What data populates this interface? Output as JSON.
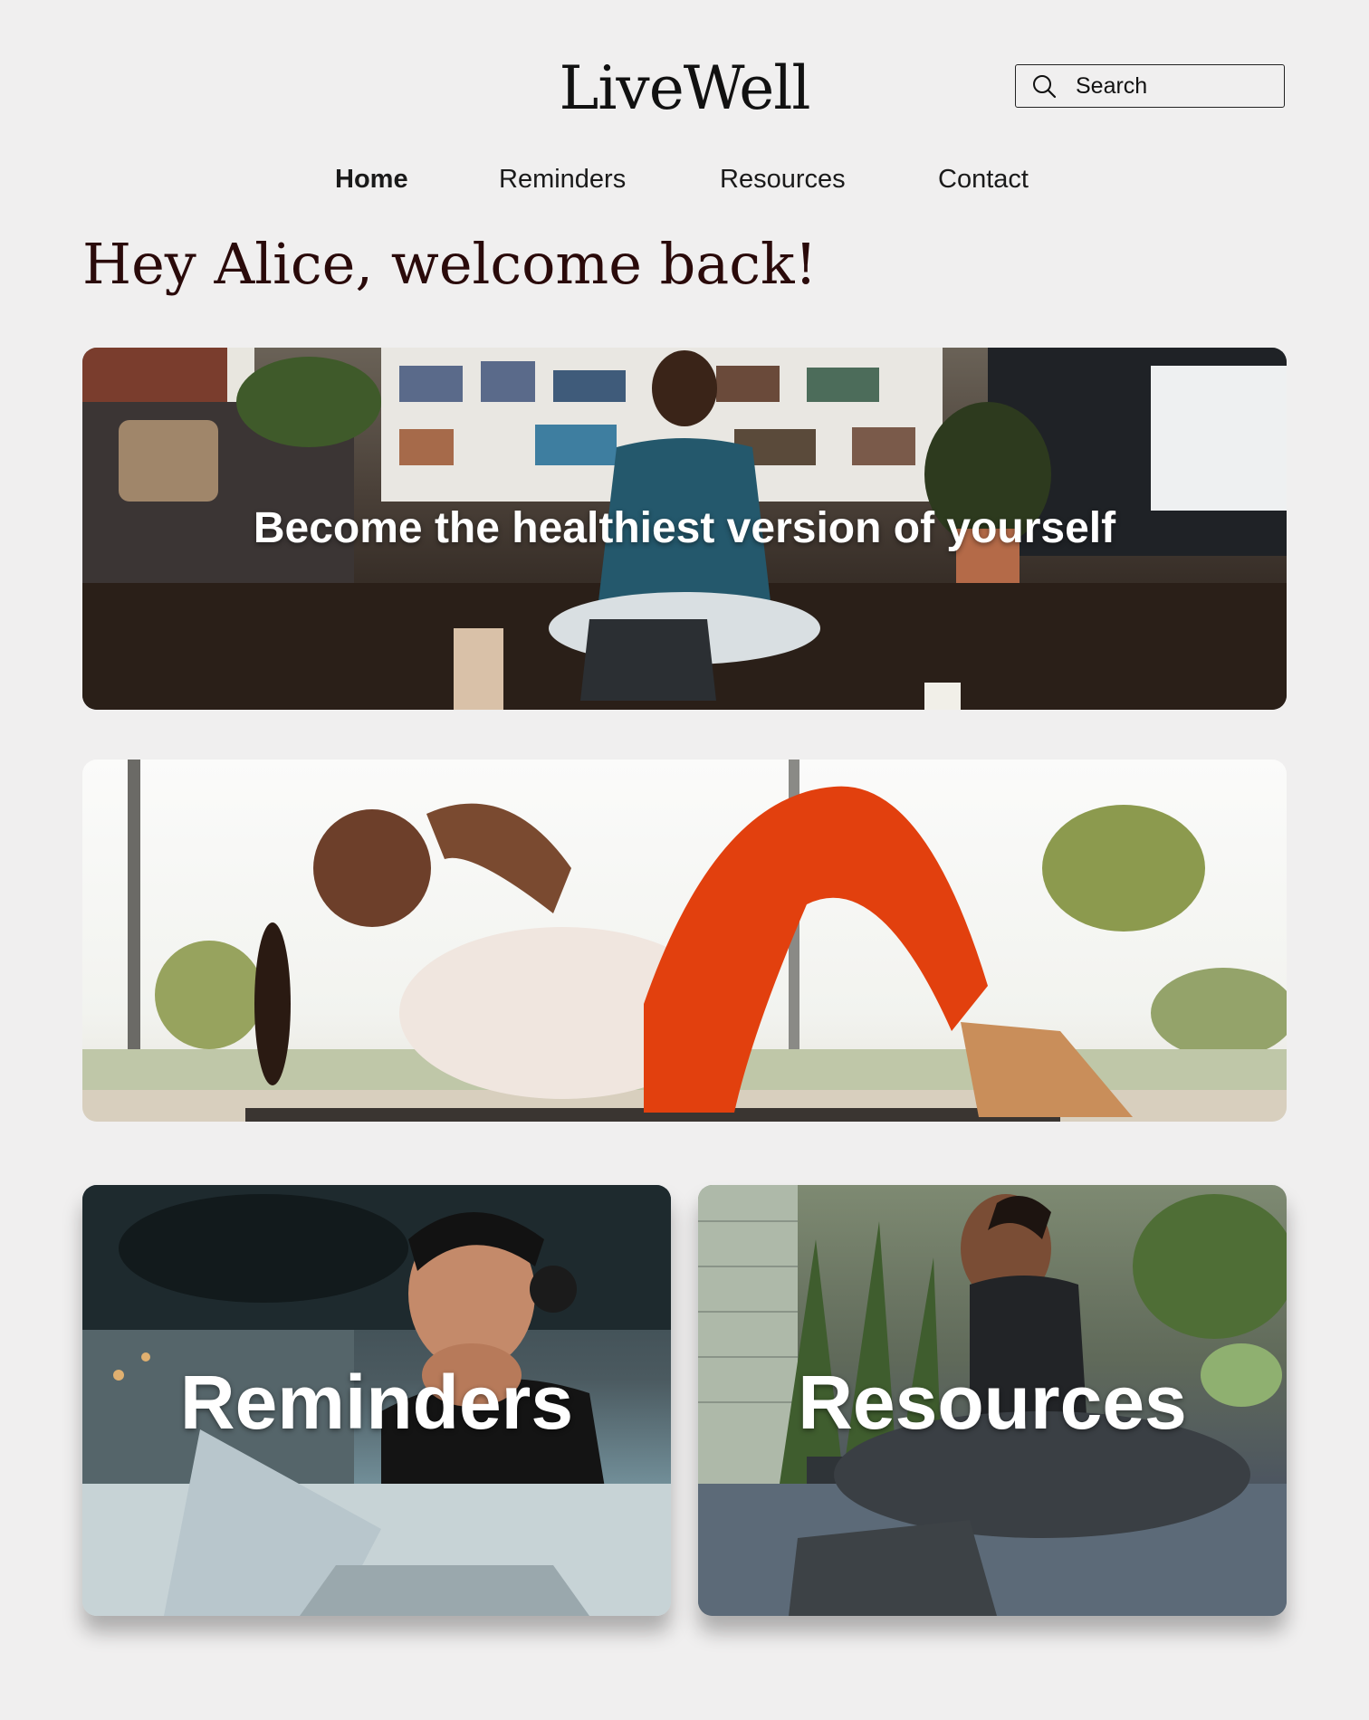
{
  "header": {
    "logo": "LiveWell",
    "search": {
      "placeholder": "Search",
      "icon": "search-icon"
    }
  },
  "nav": {
    "items": [
      {
        "label": "Home",
        "active": true
      },
      {
        "label": "Reminders",
        "active": false
      },
      {
        "label": "Resources",
        "active": false
      },
      {
        "label": "Contact",
        "active": false
      }
    ]
  },
  "main": {
    "greeting": "Hey Alice, welcome back!",
    "hero": {
      "caption": "Become the healthiest version of yourself"
    },
    "tiles": [
      {
        "label": "Reminders"
      },
      {
        "label": "Resources"
      }
    ]
  },
  "colors": {
    "background": "#f0efef",
    "greeting_text": "#2a0a0a",
    "overlay_text": "#ffffff"
  }
}
